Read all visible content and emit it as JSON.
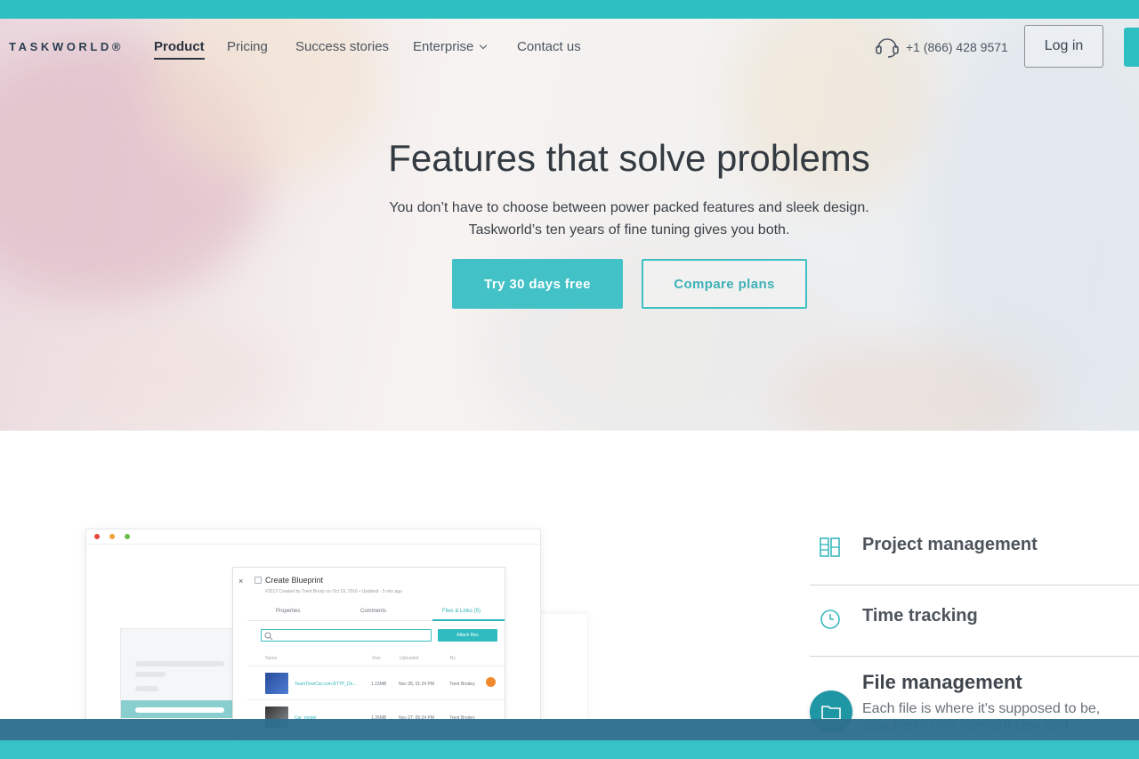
{
  "brand": {
    "logo": "TASKWORLD®"
  },
  "nav": {
    "items": [
      {
        "label": "Product",
        "active": true
      },
      {
        "label": "Pricing"
      },
      {
        "label": "Success stories"
      },
      {
        "label": "Enterprise"
      },
      {
        "label": "Contact us"
      }
    ],
    "phone": "+1 (866) 428 9571",
    "login_label": "Log in"
  },
  "hero": {
    "title": "Features that solve problems",
    "subtitle_line1": "You don’t have to choose between power packed features and sleek design.",
    "subtitle_line2": "Taskworld’s ten years of fine tuning gives you both.",
    "primary_cta": "Try 30 days free",
    "secondary_cta": "Compare plans"
  },
  "mock": {
    "task_title": "Create Blueprint",
    "task_meta": "#3212 Created by Trent Brody on Oct 19, 2016 • Updated · 5 min ago",
    "tabs": [
      "Properties",
      "Comments",
      "Files & Links (5)"
    ],
    "attach_label": "Attach files",
    "columns": [
      "Name",
      "Size",
      "Uploaded",
      "By"
    ],
    "files": [
      {
        "name": "TeamTimeCar.com-BTTP_De...",
        "size": "1.15MB",
        "uploaded": "Nov 28, 01:24 PM",
        "by": "Trent Brodey"
      },
      {
        "name": "Car_model",
        "size": "1.35MB",
        "uploaded": "Nov 27, 05:24 PM",
        "by": "Trent Brodey"
      }
    ]
  },
  "features": [
    {
      "title": "Project management",
      "icon": "board-icon"
    },
    {
      "title": "Time tracking",
      "icon": "clock-icon"
    },
    {
      "title": "File management",
      "icon": "folder-icon",
      "description": "Each file is where it's supposed to be, attached to the relevant task and"
    }
  ],
  "colors": {
    "accent": "#2ebfc2",
    "dark_text": "#333a41",
    "band": "#2e6f8e"
  }
}
